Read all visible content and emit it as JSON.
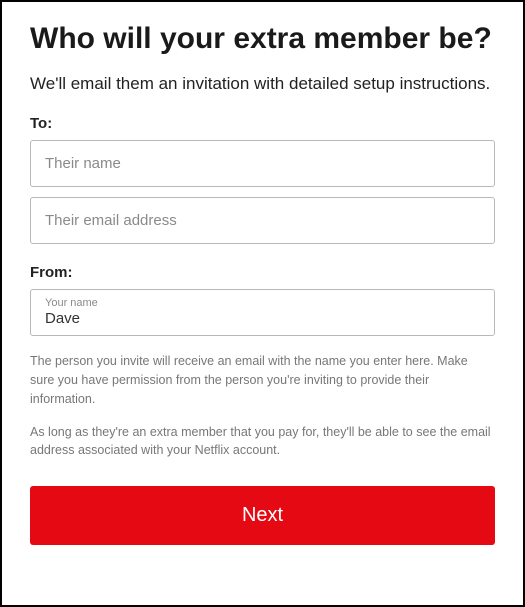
{
  "heading": "Who will your extra member be?",
  "subheading": "We'll email them an invitation with detailed setup instructions.",
  "to": {
    "label": "To:",
    "name_placeholder": "Their name",
    "name_value": "",
    "email_placeholder": "Their email address",
    "email_value": ""
  },
  "from": {
    "label": "From:",
    "floating_label": "Your name",
    "name_value": "Dave"
  },
  "disclaimer1": "The person you invite will receive an email with the name you enter here. Make sure you have permission from the person you're inviting to provide their information.",
  "disclaimer2": "As long as they're an extra member that you pay for, they'll be able to see the email address associated with your Netflix account.",
  "next_button": "Next",
  "colors": {
    "accent": "#e50914"
  }
}
